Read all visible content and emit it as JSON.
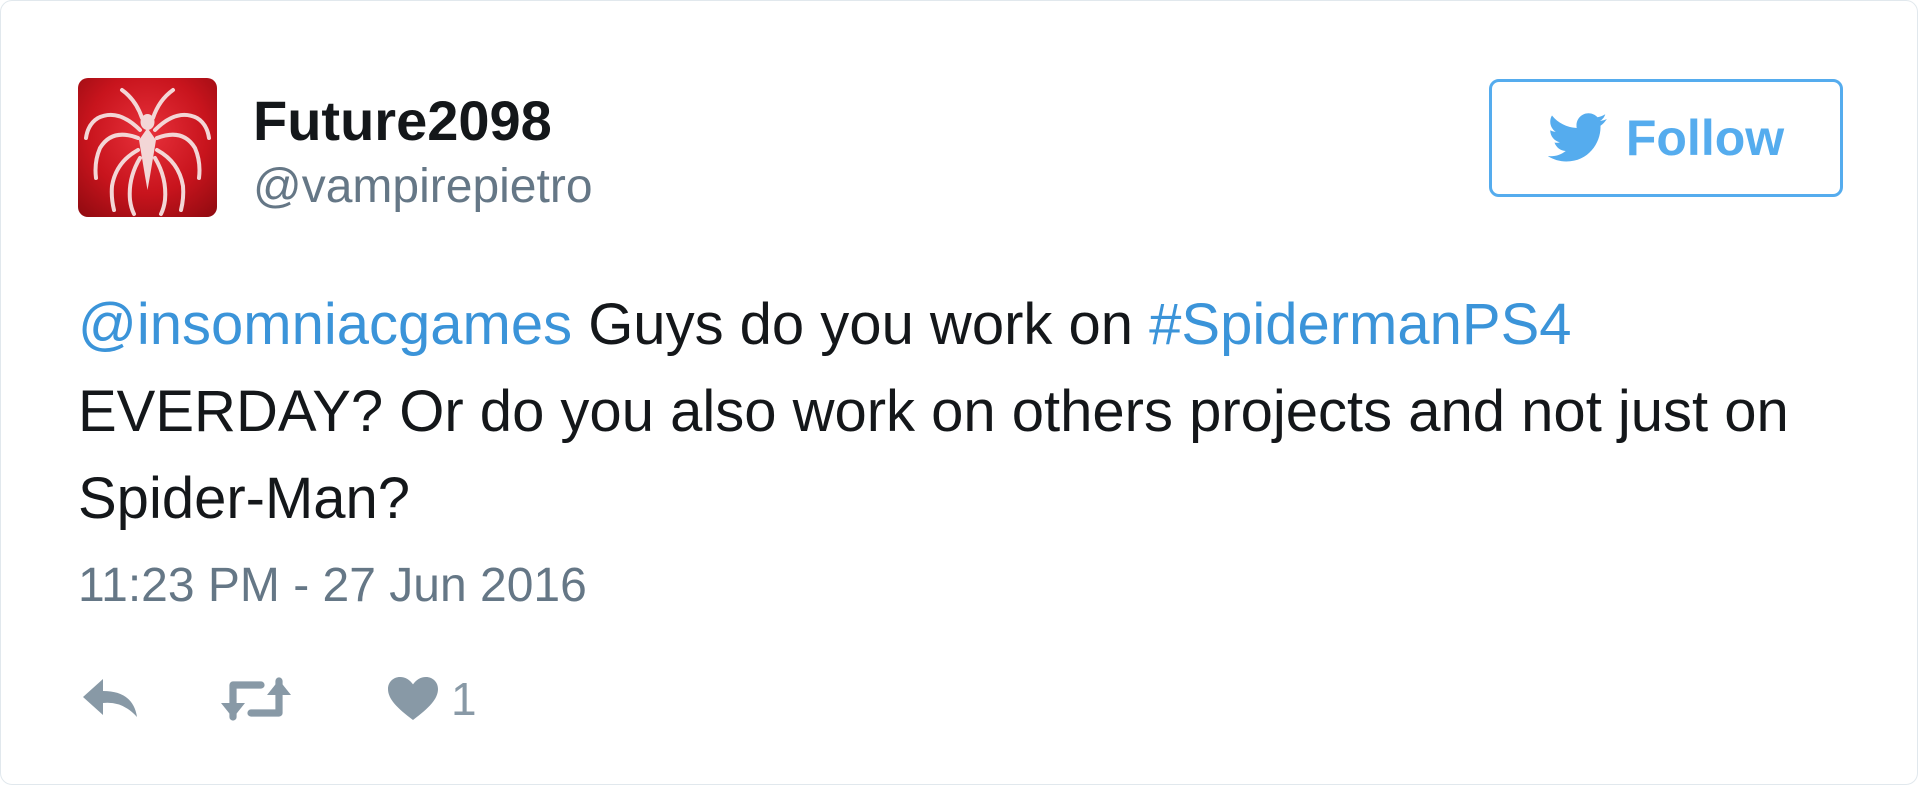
{
  "user": {
    "name": "Future2098",
    "handle": "@vampirepietro",
    "avatar_icon": "spider-emblem-icon"
  },
  "follow": {
    "label": "Follow",
    "icon": "twitter-bird-icon"
  },
  "tweet": {
    "mention": "@insomniacgames",
    "text_part1": " Guys do you work on ",
    "hashtag": "#SpidermanPS4",
    "text_part2": " EVERDAY? Or do you also work on others projects and not just on Spider-Man?"
  },
  "timestamp": "11:23 PM - 27 Jun 2016",
  "actions": {
    "reply_icon": "reply-icon",
    "retweet_icon": "retweet-icon",
    "like_icon": "heart-icon",
    "like_count": "1"
  },
  "colors": {
    "link": "#3b94d9",
    "follow_accent": "#55acee",
    "text": "#14171a",
    "muted": "#657786",
    "action_gray": "#8899a6",
    "avatar_red": "#c8141d"
  }
}
